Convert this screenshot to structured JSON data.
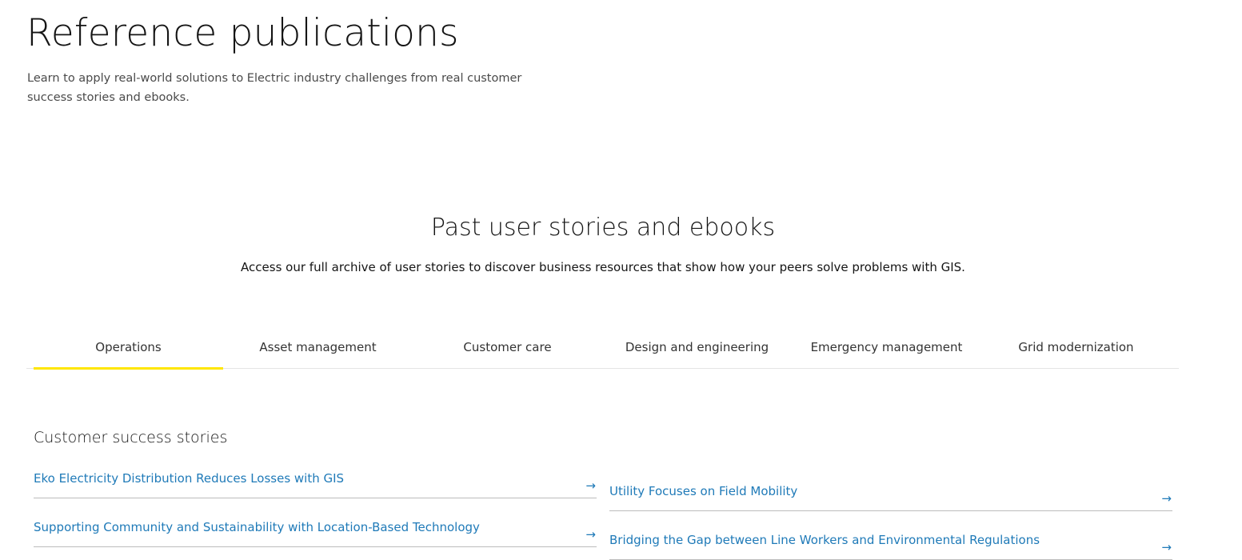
{
  "header": {
    "title": "Reference publications",
    "intro": "Learn to apply real-world solutions to Electric industry challenges from real customer success stories and ebooks."
  },
  "section": {
    "title": "Past user stories and ebooks",
    "subtitle": "Access our full archive of user stories to discover business resources that show how your peers solve problems with GIS."
  },
  "tabs": [
    {
      "label": "Operations",
      "active": true
    },
    {
      "label": "Asset management",
      "active": false
    },
    {
      "label": "Customer care",
      "active": false
    },
    {
      "label": "Design and engineering",
      "active": false
    },
    {
      "label": "Emergency management",
      "active": false
    },
    {
      "label": "Grid modernization",
      "active": false
    }
  ],
  "stories": {
    "heading": "Customer success stories",
    "arrow_icon": "arrow-right-icon",
    "arrow_glyph": "→",
    "left": [
      {
        "label": "Eko Electricity Distribution Reduces Losses with GIS"
      },
      {
        "label": "Supporting Community and Sustainability with Location-Based Technology"
      }
    ],
    "right": [
      {
        "label": "Utility Focuses on Field Mobility"
      },
      {
        "label": "Bridging the Gap between Line Workers and Environmental Regulations"
      }
    ]
  },
  "colors": {
    "accent": "#ffe600",
    "link": "#1f7ab8",
    "divider": "#bcbcbc"
  }
}
